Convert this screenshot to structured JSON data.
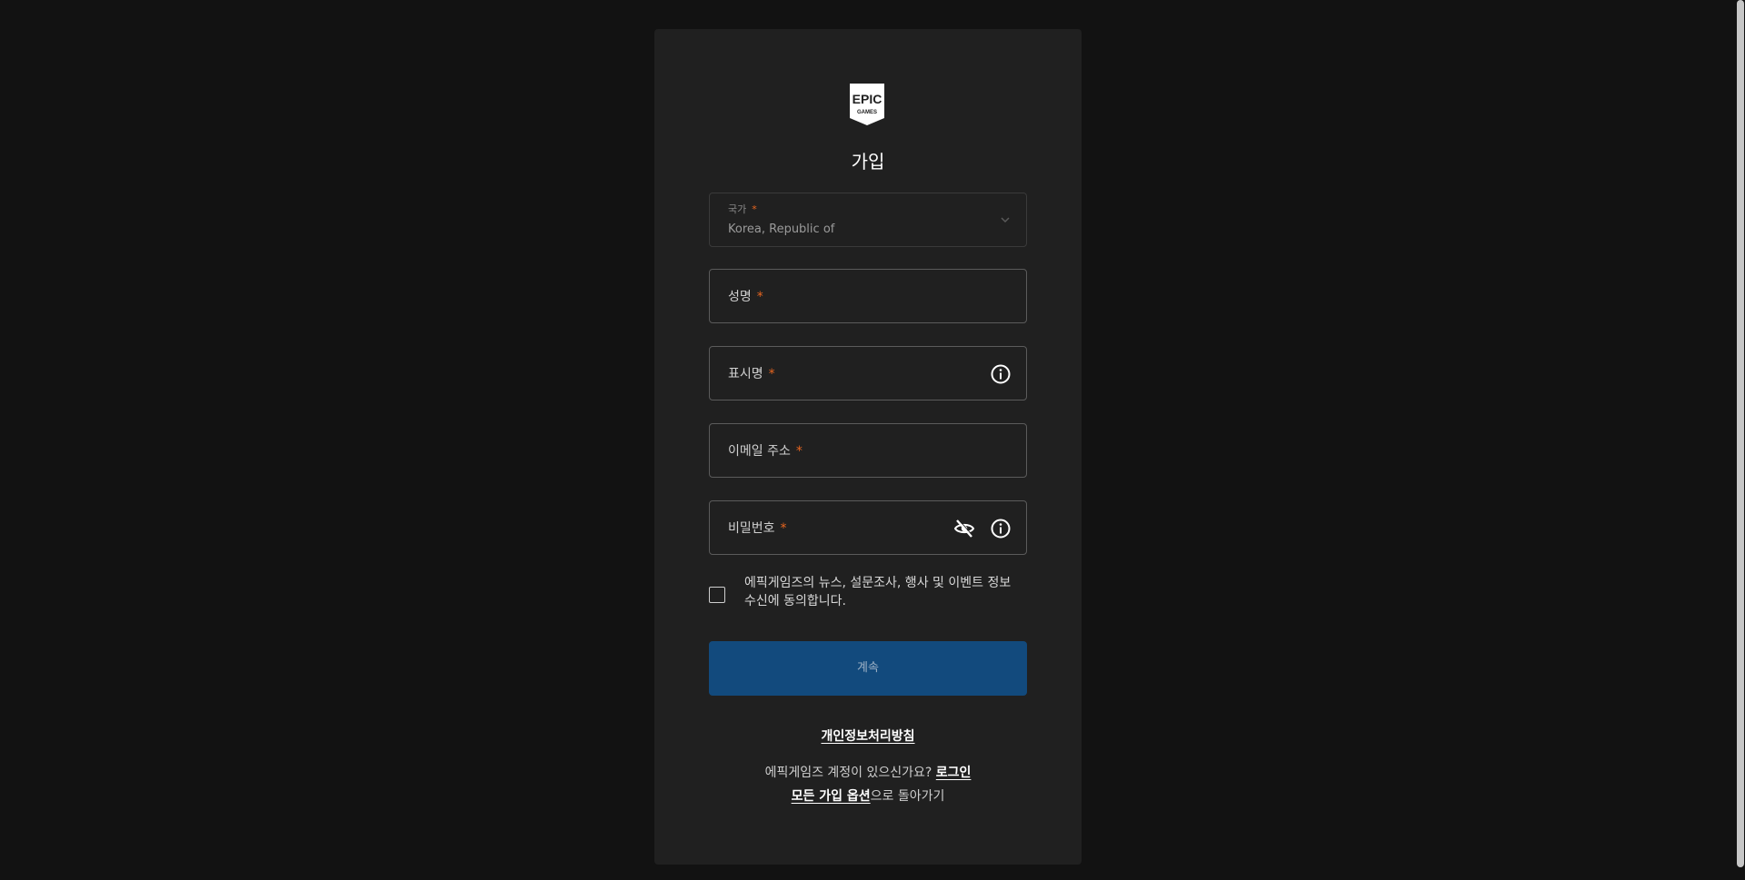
{
  "brand": {
    "logo_line1": "EPIC",
    "logo_line2": "GAMES"
  },
  "title": "가입",
  "form": {
    "country": {
      "label": "국가",
      "required_mark": "*",
      "value": "Korea, Republic of"
    },
    "full_name": {
      "label": "성명",
      "required_mark": "*"
    },
    "display_name": {
      "label": "표시명",
      "required_mark": "*",
      "info_icon": "info-icon"
    },
    "email": {
      "label": "이메일 주소",
      "required_mark": "*"
    },
    "password": {
      "label": "비밀번호",
      "required_mark": "*",
      "visibility_icon": "eye-off-icon",
      "info_icon": "info-icon"
    },
    "marketing_consent": {
      "label": "에픽게임즈의 뉴스, 설문조사, 행사 및 이벤트 정보 수신에 동의합니다.",
      "checked": false
    },
    "continue_label": "계속"
  },
  "links": {
    "privacy_policy": "개인정보처리방침",
    "have_account": "에픽게임즈 계정이 있으신가요?",
    "login": "로그인",
    "all_signup_options": "모든 가입 옵션",
    "back_suffix": "으로 돌아가기"
  },
  "colors": {
    "background": "#121212",
    "card": "#202020",
    "required": "#e7651f",
    "primary_button": "#124a7d"
  }
}
